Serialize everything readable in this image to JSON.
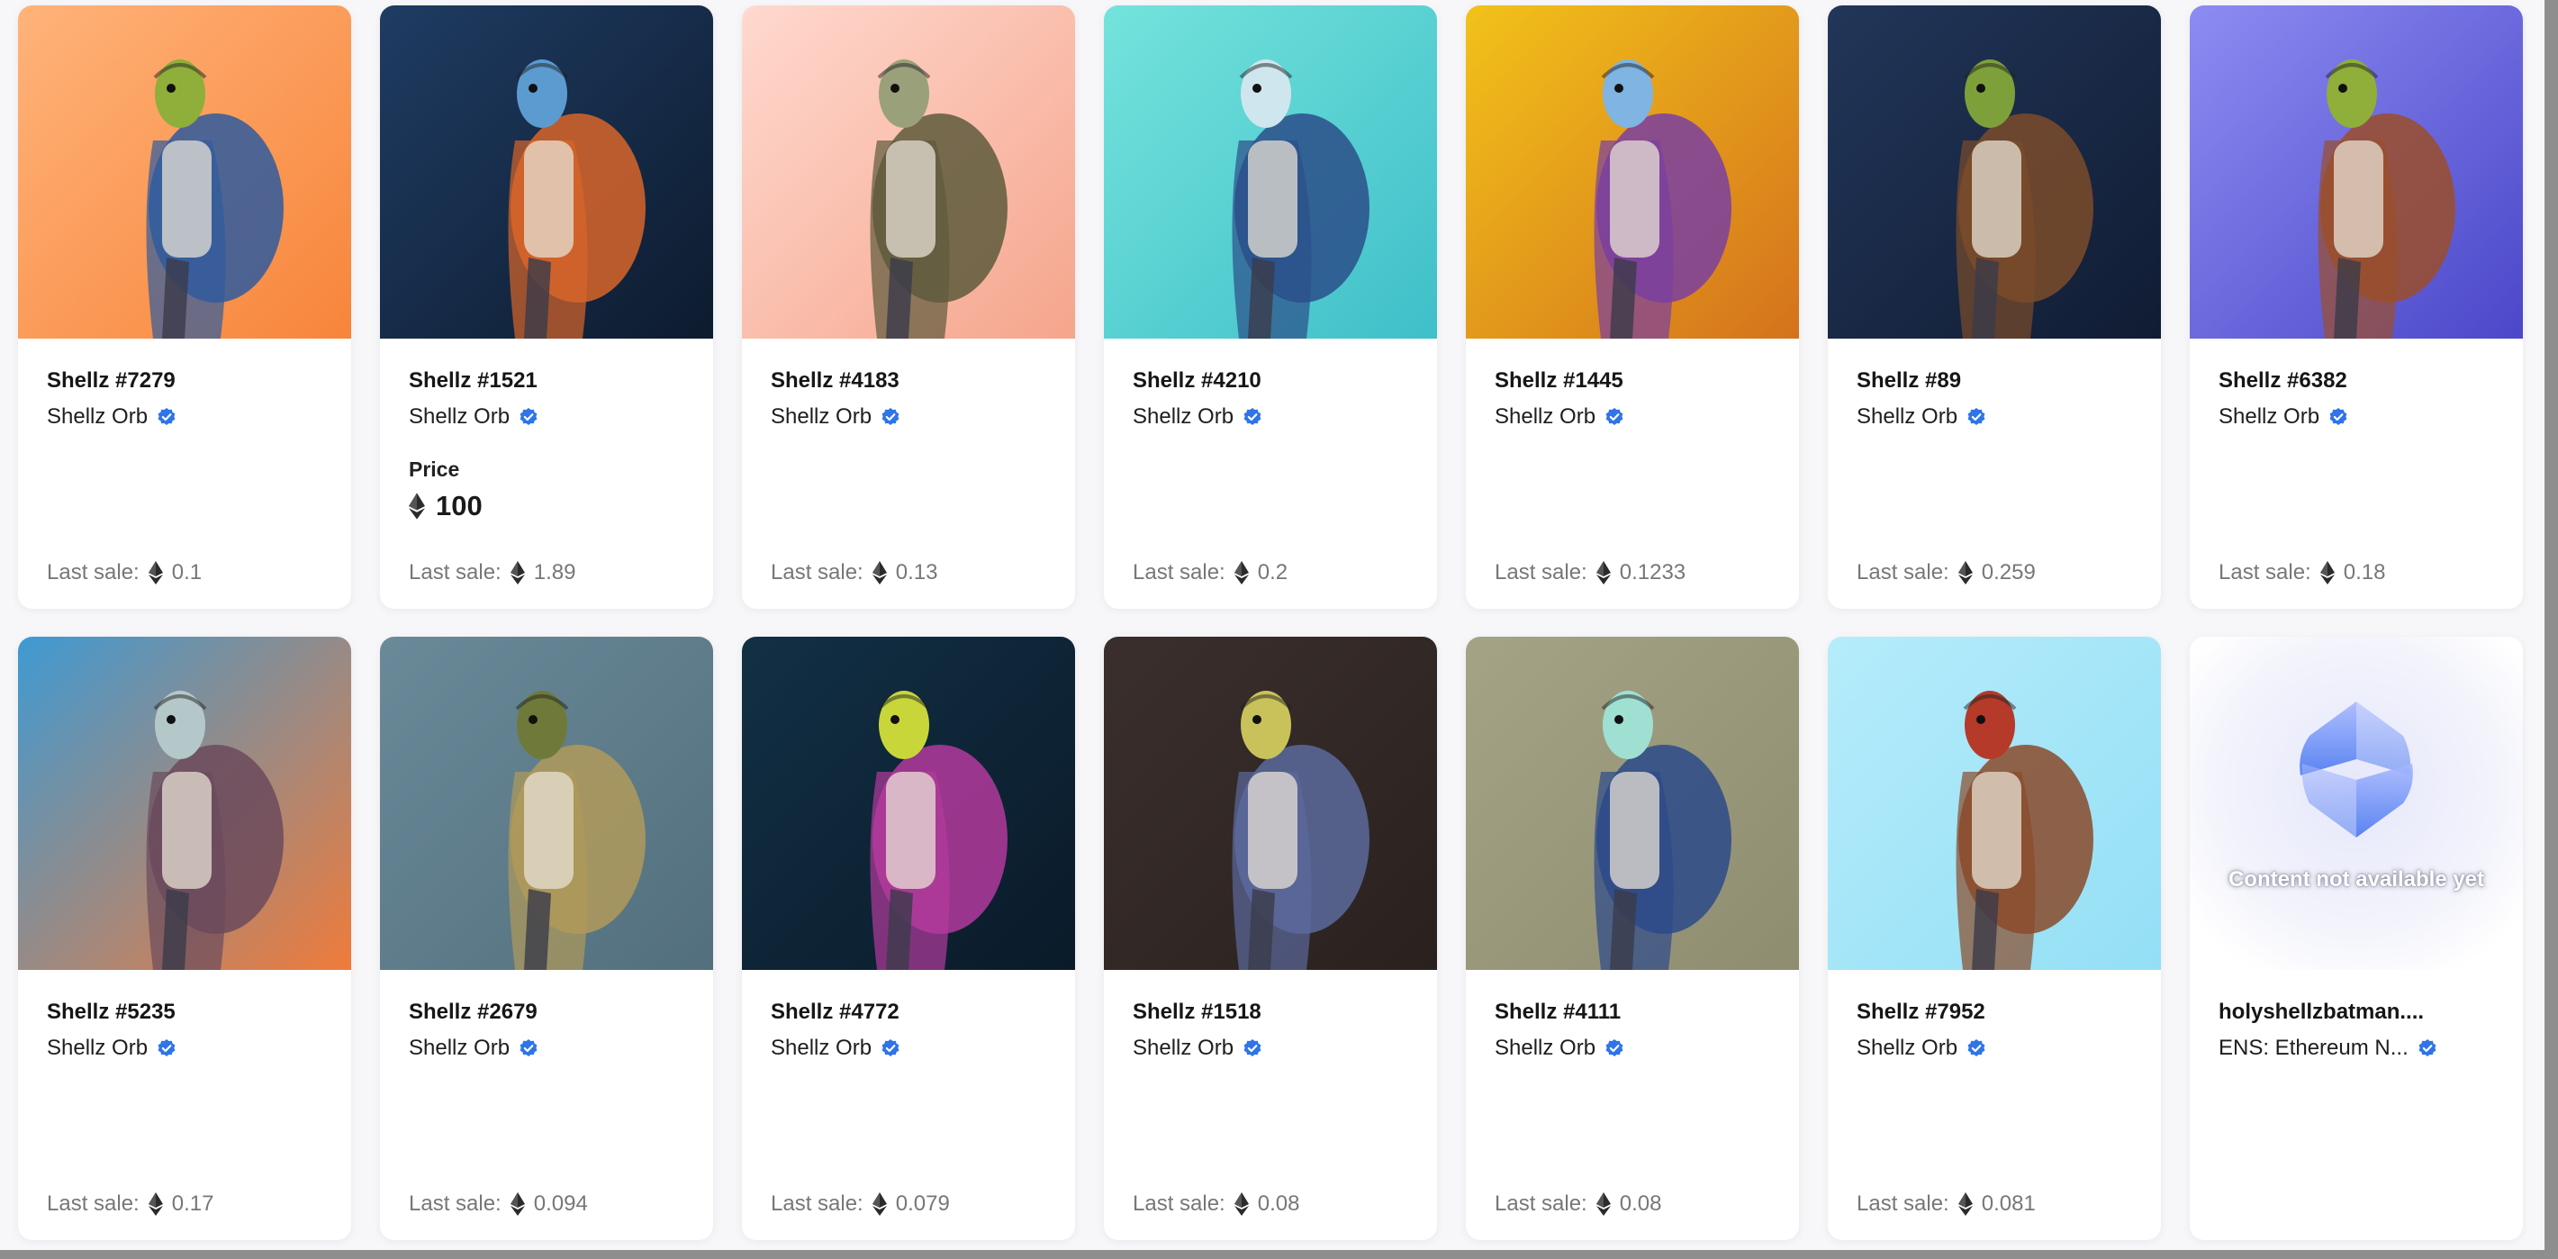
{
  "labels": {
    "last_sale": "Last sale:",
    "price": "Price",
    "not_available": "Content not available yet"
  },
  "items": [
    {
      "name": "Shellz #7279",
      "collection": "Shellz Orb",
      "verified": true,
      "last_sale": "0.1",
      "art": {
        "bg1": "#ffb37a",
        "bg2": "#f7853a",
        "accent": "#2f5b9e",
        "skin": "#8fae3a"
      }
    },
    {
      "name": "Shellz #1521",
      "collection": "Shellz Orb",
      "verified": true,
      "price": "100",
      "last_sale": "1.89",
      "art": {
        "bg1": "#1f3c63",
        "bg2": "#0d1b2e",
        "accent": "#d8652a",
        "skin": "#5c9bcf"
      }
    },
    {
      "name": "Shellz #4183",
      "collection": "Shellz Orb",
      "verified": true,
      "last_sale": "0.13",
      "art": {
        "bg1": "#ffd9cf",
        "bg2": "#f5a58c",
        "accent": "#5e5a3c",
        "skin": "#9aa07a"
      }
    },
    {
      "name": "Shellz #4210",
      "collection": "Shellz Orb",
      "verified": true,
      "last_sale": "0.2",
      "art": {
        "bg1": "#74e3dc",
        "bg2": "#3fbfc9",
        "accent": "#2b4f8a",
        "skin": "#cfe6ee"
      }
    },
    {
      "name": "Shellz #1445",
      "collection": "Shellz Orb",
      "verified": true,
      "last_sale": "0.1233",
      "art": {
        "bg1": "#f2c21a",
        "bg2": "#d4721c",
        "accent": "#7a3fa0",
        "skin": "#7fb4e3"
      }
    },
    {
      "name": "Shellz #89",
      "collection": "Shellz Orb",
      "verified": true,
      "last_sale": "0.259",
      "art": {
        "bg1": "#223659",
        "bg2": "#101c33",
        "accent": "#7b4b2a",
        "skin": "#7ea03a"
      }
    },
    {
      "name": "Shellz #6382",
      "collection": "Shellz Orb",
      "verified": true,
      "last_sale": "0.18",
      "art": {
        "bg1": "#8d8cf2",
        "bg2": "#4b47c9",
        "accent": "#9b4e2a",
        "skin": "#8fae3a"
      }
    },
    {
      "name": "Shellz #5235",
      "collection": "Shellz Orb",
      "verified": true,
      "last_sale": "0.17",
      "art": {
        "bg1": "#3e9ad3",
        "bg2": "#f07b3a",
        "accent": "#6b4a5c",
        "skin": "#b5c8c9"
      }
    },
    {
      "name": "Shellz #2679",
      "collection": "Shellz Orb",
      "verified": true,
      "last_sale": "0.094",
      "art": {
        "bg1": "#6a8a99",
        "bg2": "#536f7d",
        "accent": "#b09a5a",
        "skin": "#6f7a3a"
      }
    },
    {
      "name": "Shellz #4772",
      "collection": "Shellz Orb",
      "verified": true,
      "last_sale": "0.079",
      "art": {
        "bg1": "#123045",
        "bg2": "#0a1a29",
        "accent": "#b33a9c",
        "skin": "#c9d63a"
      }
    },
    {
      "name": "Shellz #1518",
      "collection": "Shellz Orb",
      "verified": true,
      "last_sale": "0.08",
      "art": {
        "bg1": "#3a2f2c",
        "bg2": "#2a211f",
        "accent": "#5b6a9c",
        "skin": "#c9c25a"
      }
    },
    {
      "name": "Shellz #4111",
      "collection": "Shellz Orb",
      "verified": true,
      "last_sale": "0.08",
      "art": {
        "bg1": "#a5a386",
        "bg2": "#8f8d70",
        "accent": "#2c4a8a",
        "skin": "#9fe0d2"
      }
    },
    {
      "name": "Shellz #7952",
      "collection": "Shellz Orb",
      "verified": true,
      "last_sale": "0.081",
      "art": {
        "bg1": "#b5ecfb",
        "bg2": "#94dff5",
        "accent": "#8a4a2a",
        "skin": "#b53a2a"
      }
    },
    {
      "name": "holyshellzbatman....",
      "collection": "ENS: Ethereum N...",
      "verified": true,
      "unavailable": true
    }
  ],
  "colors": {
    "verified_badge": "#2f74e8",
    "ens_logo_top": "#a8b9ff",
    "ens_logo_bottom": "#4a78f0"
  },
  "icons": {
    "verified": "verified-check-icon",
    "eth": "ethereum-icon",
    "ens": "ens-logo-icon"
  }
}
